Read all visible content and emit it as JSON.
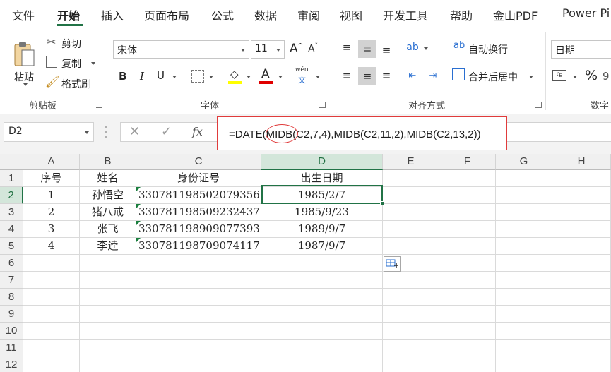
{
  "tabs": [
    "文件",
    "开始",
    "插入",
    "页面布局",
    "公式",
    "数据",
    "审阅",
    "视图",
    "开发工具",
    "帮助",
    "金山PDF",
    "Power Pi"
  ],
  "active_tab": "开始",
  "ribbon": {
    "clipboard": {
      "paste": "粘贴",
      "cut": "剪切",
      "copy": "复制",
      "format_painter": "格式刷",
      "label": "剪贴板"
    },
    "font": {
      "name": "宋体",
      "size": "11",
      "label": "字体",
      "bold": "B",
      "italic": "I",
      "underline": "U",
      "grow": "A",
      "shrink": "A",
      "phonetic": "wén",
      "phonetic_sub": "文",
      "fill_color": "#ffff00",
      "font_color": "#e00000"
    },
    "alignment": {
      "wrap": "自动换行",
      "merge": "合并后居中",
      "label": "对齐方式"
    },
    "number": {
      "format": "日期",
      "percent": "%",
      "label": "数字"
    }
  },
  "formula_bar": {
    "name_box": "D2",
    "fx": "fx",
    "formula": "=DATE(MIDB(C2,7,4),MIDB(C2,11,2),MIDB(C2,13,2))",
    "highlight_color": "#e03b3b"
  },
  "columns": [
    "A",
    "B",
    "C",
    "D",
    "E",
    "F",
    "G",
    "H"
  ],
  "rows": [
    "1",
    "2",
    "3",
    "4",
    "5",
    "6",
    "7",
    "8",
    "9",
    "10",
    "11",
    "12"
  ],
  "table": {
    "header": [
      "序号",
      "姓名",
      "身份证号",
      "出生日期"
    ],
    "data": [
      [
        "1",
        "孙悟空",
        "330781198502079356",
        "1985/2/7"
      ],
      [
        "2",
        "猪八戒",
        "330781198509232437",
        "1985/9/23"
      ],
      [
        "3",
        "张飞",
        "330781198909077393",
        "1989/9/7"
      ],
      [
        "4",
        "李逵",
        "330781198709074117",
        "1987/9/7"
      ]
    ]
  },
  "selected_cell": "D2",
  "accent_color": "#217346"
}
